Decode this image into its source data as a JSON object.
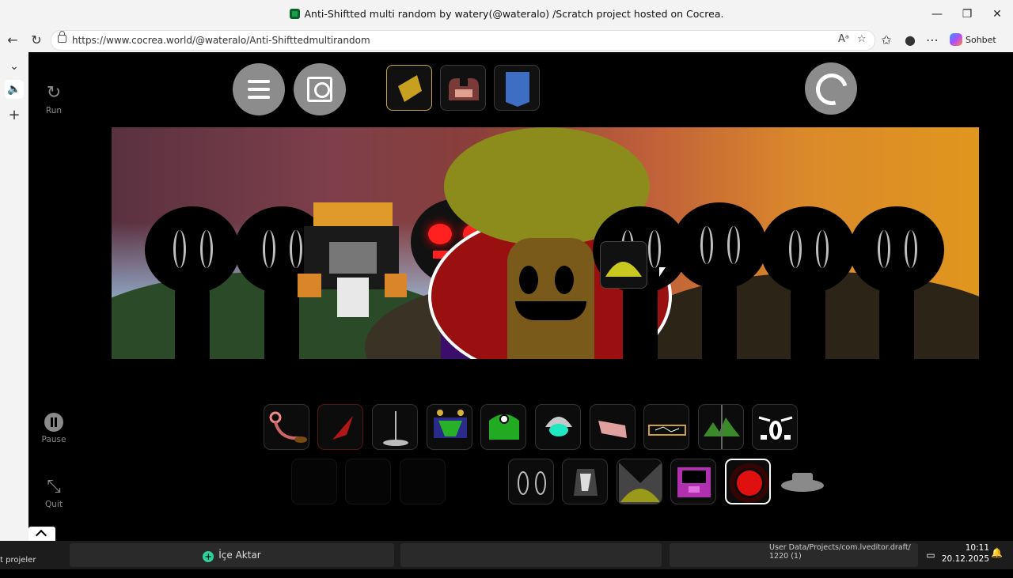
{
  "window": {
    "title": "Anti-Shiftted multi random by watery(@wateralo) /Scratch project hosted on Cocrea.",
    "minimize_icon": "minimize-icon",
    "maximize_icon": "restore-icon",
    "close_icon": "close-icon"
  },
  "browser": {
    "url": "https://www.cocrea.world/@wateralo/Anti-Shifttedmultirandom",
    "copilot_label": "Sohbet et"
  },
  "player": {
    "run_label": "Run",
    "pause_label": "Pause",
    "quit_label": "Quit"
  },
  "taskbar": {
    "left_label": "t projeler",
    "import_label": "İçe Aktar",
    "path_line1": "User Data/Projects/com.lveditor.draft/",
    "path_line2": "1220 (1)",
    "time": "10:11",
    "date": "20.12.2025"
  },
  "colors": {
    "selected_category_border": "#c7a64a",
    "selected_icon_border": "#ffffff"
  }
}
